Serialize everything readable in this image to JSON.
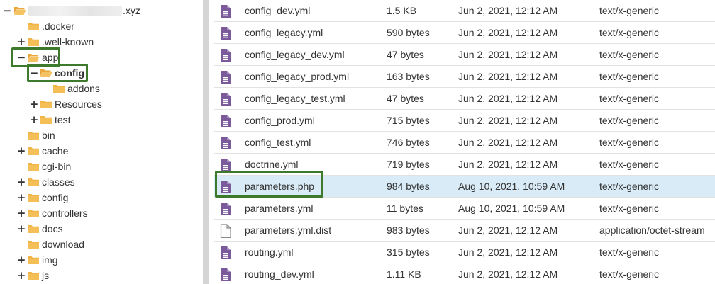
{
  "tree": {
    "root_suffix": ".xyz",
    "items": [
      {
        "label": ".docker",
        "toggle": ""
      },
      {
        "label": ".well-known",
        "toggle": "+"
      },
      {
        "label": "app",
        "toggle": "−"
      },
      {
        "label": "config",
        "toggle": "−"
      },
      {
        "label": "addons",
        "toggle": ""
      },
      {
        "label": "Resources",
        "toggle": "+"
      },
      {
        "label": "test",
        "toggle": "+"
      },
      {
        "label": "bin",
        "toggle": ""
      },
      {
        "label": "cache",
        "toggle": "+"
      },
      {
        "label": "cgi-bin",
        "toggle": ""
      },
      {
        "label": "classes",
        "toggle": "+"
      },
      {
        "label": "config",
        "toggle": "+"
      },
      {
        "label": "controllers",
        "toggle": "+"
      },
      {
        "label": "docs",
        "toggle": "+"
      },
      {
        "label": "download",
        "toggle": ""
      },
      {
        "label": "img",
        "toggle": "+"
      },
      {
        "label": "js",
        "toggle": "+"
      }
    ],
    "root_toggle": "−"
  },
  "files": [
    {
      "name": "config_dev.yml",
      "size": "1.5 KB",
      "modified": "Jun 2, 2021, 12:12 AM",
      "type": "text/x-generic"
    },
    {
      "name": "config_legacy.yml",
      "size": "590 bytes",
      "modified": "Jun 2, 2021, 12:12 AM",
      "type": "text/x-generic"
    },
    {
      "name": "config_legacy_dev.yml",
      "size": "47 bytes",
      "modified": "Jun 2, 2021, 12:12 AM",
      "type": "text/x-generic"
    },
    {
      "name": "config_legacy_prod.yml",
      "size": "163 bytes",
      "modified": "Jun 2, 2021, 12:12 AM",
      "type": "text/x-generic"
    },
    {
      "name": "config_legacy_test.yml",
      "size": "47 bytes",
      "modified": "Jun 2, 2021, 12:12 AM",
      "type": "text/x-generic"
    },
    {
      "name": "config_prod.yml",
      "size": "715 bytes",
      "modified": "Jun 2, 2021, 12:12 AM",
      "type": "text/x-generic"
    },
    {
      "name": "config_test.yml",
      "size": "746 bytes",
      "modified": "Jun 2, 2021, 12:12 AM",
      "type": "text/x-generic"
    },
    {
      "name": "doctrine.yml",
      "size": "719 bytes",
      "modified": "Jun 2, 2021, 12:12 AM",
      "type": "text/x-generic"
    },
    {
      "name": "parameters.php",
      "size": "984 bytes",
      "modified": "Aug 10, 2021, 10:59 AM",
      "type": "text/x-generic"
    },
    {
      "name": "parameters.yml",
      "size": "11 bytes",
      "modified": "Aug 10, 2021, 10:59 AM",
      "type": "text/x-generic"
    },
    {
      "name": "parameters.yml.dist",
      "size": "983 bytes",
      "modified": "Jun 2, 2021, 12:12 AM",
      "type": "application/octet-stream"
    },
    {
      "name": "routing.yml",
      "size": "315 bytes",
      "modified": "Jun 2, 2021, 12:12 AM",
      "type": "text/x-generic"
    },
    {
      "name": "routing_dev.yml",
      "size": "1.11 KB",
      "modified": "Jun 2, 2021, 12:12 AM",
      "type": "text/x-generic"
    }
  ],
  "icons": {
    "folder": "folder-icon",
    "folder_open": "folder-open-icon",
    "file_text": "text-file-icon",
    "file_blank": "blank-file-icon"
  },
  "colors": {
    "folder": "#f0b546",
    "file_text": "#7a5a9a",
    "highlight_row": "#d9ebf7",
    "annotation": "#3e7a2c"
  }
}
